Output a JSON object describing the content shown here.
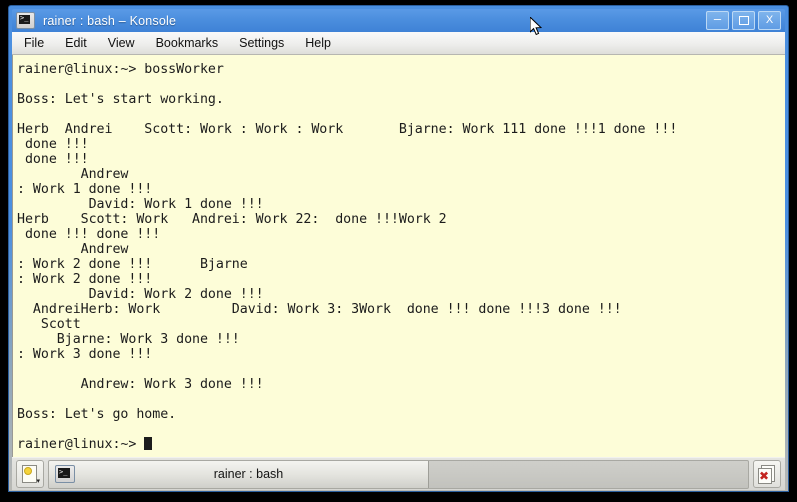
{
  "window": {
    "title": "rainer : bash – Konsole",
    "icon": "terminal-icon",
    "buttons": {
      "minimize": "–",
      "maximize": "□",
      "close": "X"
    }
  },
  "menubar": {
    "items": [
      {
        "label": "File"
      },
      {
        "label": "Edit"
      },
      {
        "label": "View"
      },
      {
        "label": "Bookmarks"
      },
      {
        "label": "Settings"
      },
      {
        "label": "Help"
      }
    ]
  },
  "terminal": {
    "background_color": "#fdfdd8",
    "foreground_color": "#1c1c1c",
    "prompt": "rainer@linux:~>",
    "command": "bossWorker",
    "lines": [
      "rainer@linux:~> bossWorker",
      "",
      "Boss: Let's start working.",
      "",
      "Herb  Andrei    Scott: Work : Work : Work       Bjarne: Work 111 done !!!1 done !!!",
      " done !!!",
      " done !!!",
      "        Andrew",
      ": Work 1 done !!!",
      "         David: Work 1 done !!!",
      "Herb    Scott: Work   Andrei: Work 22:  done !!!Work 2",
      " done !!! done !!!",
      "        Andrew",
      ": Work 2 done !!!      Bjarne",
      ": Work 2 done !!!",
      "         David: Work 2 done !!!",
      "  AndreiHerb: Work         David: Work 3: 3Work  done !!! done !!!3 done !!!",
      "   Scott",
      "     Bjarne: Work 3 done !!!",
      ": Work 3 done !!!",
      "",
      "        Andrew: Work 3 done !!!",
      "",
      "Boss: Let's go home.",
      "",
      "rainer@linux:~> "
    ]
  },
  "tabbar": {
    "new_session_button": "new-session-icon",
    "tabs": [
      {
        "label": "rainer : bash",
        "icon": "terminal-icon",
        "active": true
      }
    ],
    "close_button": "close-session-icon"
  }
}
